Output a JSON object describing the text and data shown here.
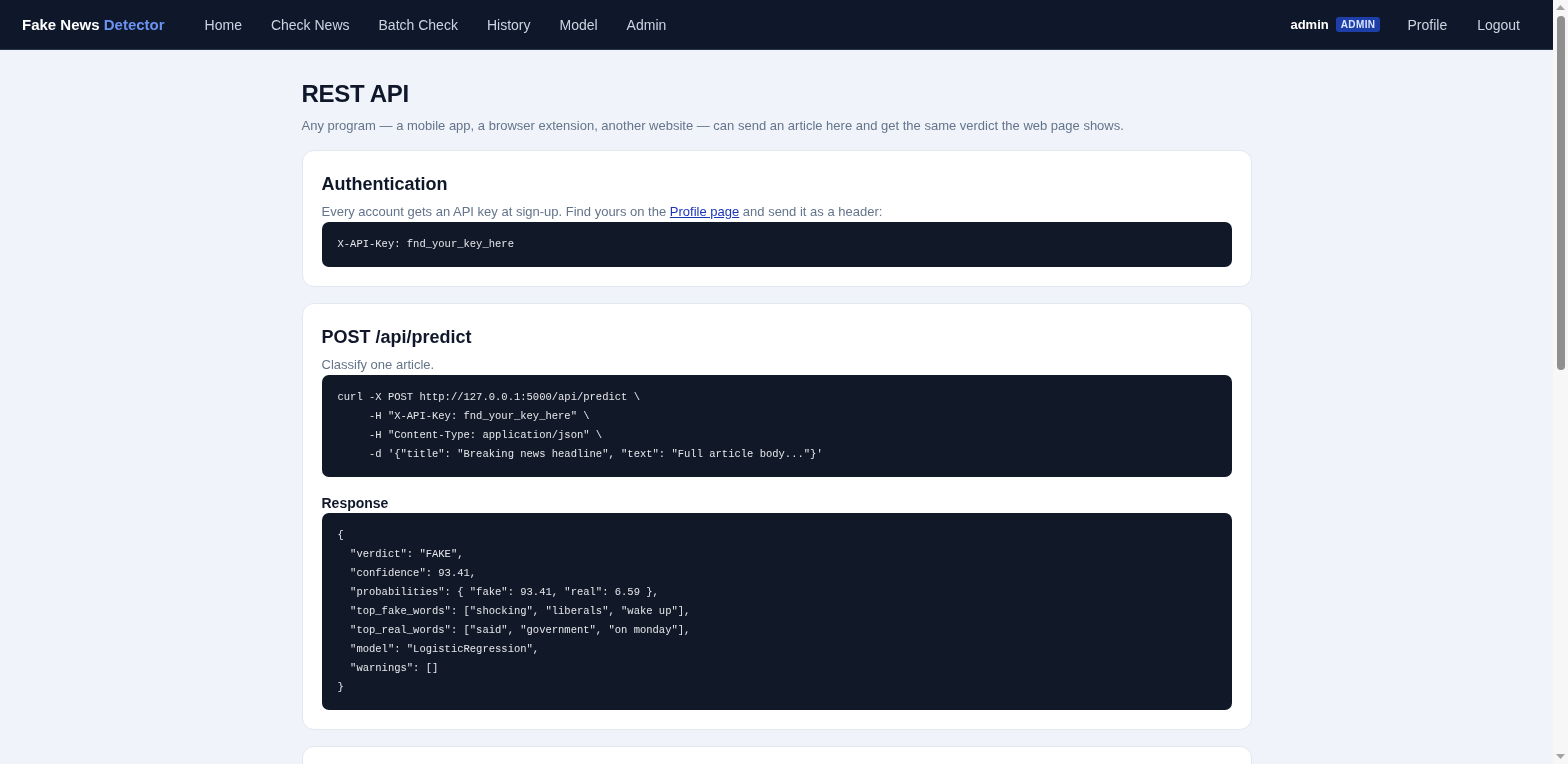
{
  "navbar": {
    "brand": {
      "text": "Fake News",
      "accent": "Detector"
    },
    "links": [
      "Home",
      "Check News",
      "Batch Check",
      "History",
      "Model",
      "Admin"
    ],
    "user": {
      "name": "admin",
      "badge": "ADMIN"
    },
    "actions": [
      "Profile",
      "Logout"
    ]
  },
  "page": {
    "title": "REST API",
    "subtitle": "Any program — a mobile app, a browser extension, another website — can send an article here and get the same verdict the web page shows."
  },
  "sections": [
    {
      "heading": "Authentication",
      "description": {
        "before": "Every account gets an API key at sign-up. Find yours on the",
        "link": "Profile page",
        "after": "and send it as a header:"
      },
      "blocks": [
        {
          "kind": "code",
          "lines": [
            "X-API-Key: fnd_your_key_here"
          ]
        }
      ]
    },
    {
      "heading": "POST /api/predict",
      "description": {
        "before": "Classify one article."
      },
      "blocks": [
        {
          "kind": "code",
          "lines": [
            "curl -X POST http://127.0.0.1:5000/api/predict \\",
            "     -H \"X-API-Key: fnd_your_key_here\" \\",
            "     -H \"Content-Type: application/json\" \\",
            "     -d '{\"title\": \"Breaking news headline\", \"text\": \"Full article body...\"}'"
          ]
        },
        {
          "kind": "label",
          "text": "Response"
        },
        {
          "kind": "code",
          "lines": [
            "{",
            "  \"verdict\": \"FAKE\",",
            "  \"confidence\": 93.41,",
            "  \"probabilities\": { \"fake\": 93.41, \"real\": 6.59 },",
            "  \"top_fake_words\": [\"shocking\", \"liberals\", \"wake up\"],",
            "  \"top_real_words\": [\"said\", \"government\", \"on monday\"],",
            "  \"model\": \"LogisticRegression\",",
            "  \"warnings\": []",
            "}"
          ]
        }
      ]
    }
  ]
}
